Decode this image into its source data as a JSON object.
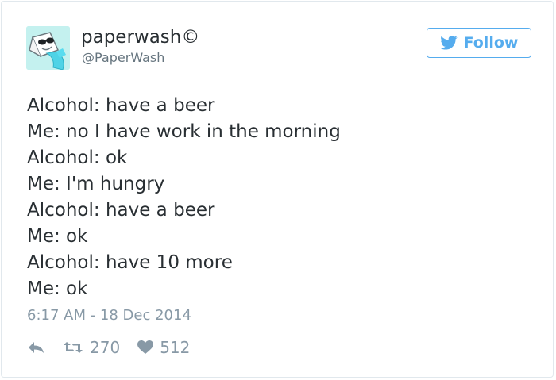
{
  "tweet": {
    "author": {
      "display_name": "paperwash©",
      "handle": "@PaperWash",
      "avatar_icon": "toilet-paper-mascot-icon"
    },
    "follow_button": {
      "label": "Follow",
      "icon": "twitter-bird-icon"
    },
    "lines": [
      "Alcohol: have a beer",
      "Me: no I have work in the morning",
      "Alcohol: ok",
      "Me: I'm hungry",
      "Alcohol: have a beer",
      "Me: ok",
      "Alcohol: have 10 more",
      "Me: ok"
    ],
    "timestamp": "6:17 AM - 18 Dec 2014",
    "actions": {
      "reply_icon": "reply-icon",
      "retweet_icon": "retweet-icon",
      "retweet_count": "270",
      "like_icon": "heart-icon",
      "like_count": "512"
    }
  },
  "colors": {
    "text": "#292f33",
    "secondary": "#66757f",
    "muted": "#8899a6",
    "accent": "#55acee",
    "border": "#e1e8ed"
  }
}
